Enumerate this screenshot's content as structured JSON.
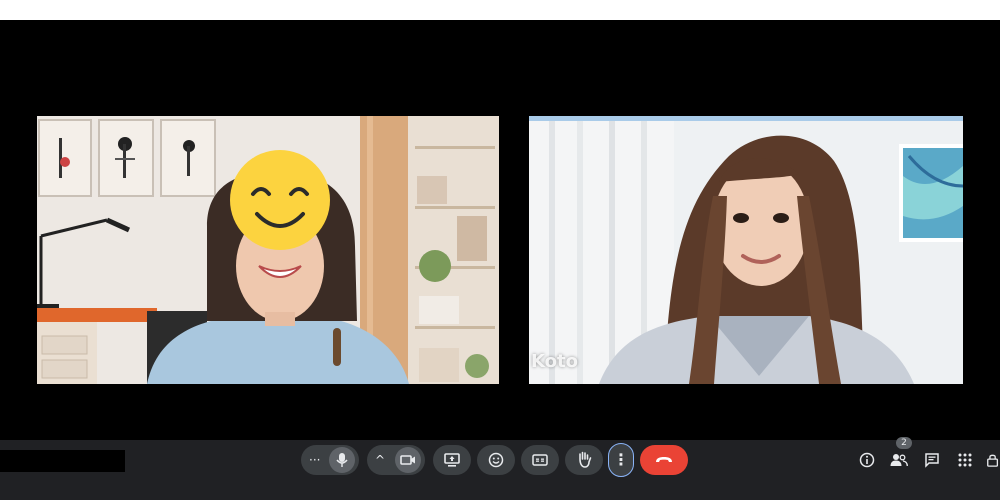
{
  "participants": [
    {
      "name": "",
      "face_covered_by": "smiling-emoji"
    },
    {
      "name": "Koto"
    }
  ],
  "controls": {
    "more_dots_label": "···",
    "caret_label": "^",
    "more_vert_label": "⋮"
  },
  "right_panel": {
    "people_count": "2"
  },
  "colors": {
    "end_call": "#ea4335",
    "toolbar_bg": "#202124",
    "button_bg": "#3c4043",
    "focus_ring": "#8ab4f8"
  }
}
